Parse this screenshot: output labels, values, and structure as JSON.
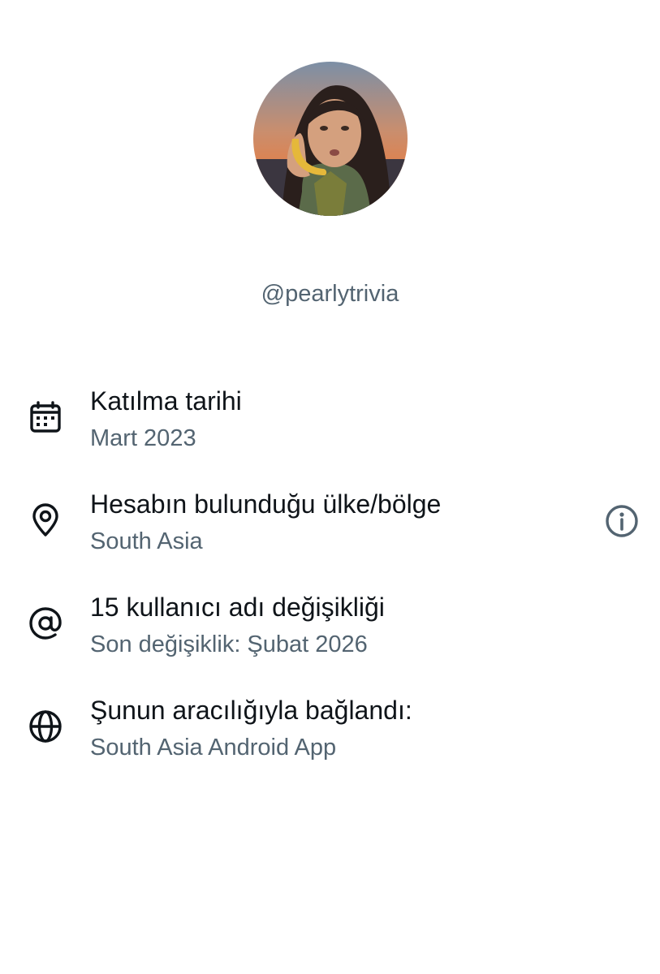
{
  "profile": {
    "handle": "@pearlytrivia",
    "avatar_description": "profile photo"
  },
  "about": {
    "items": [
      {
        "icon": "calendar-icon",
        "title": "Katılma tarihi",
        "subtitle": "Mart 2023"
      },
      {
        "icon": "location-pin-icon",
        "title": "Hesabın bulunduğu ülke/bölge",
        "subtitle": "South Asia"
      },
      {
        "icon": "at-sign-icon",
        "title": "15 kullanıcı adı değişikliği",
        "subtitle": "Son değişiklik: Şubat 2026"
      },
      {
        "icon": "globe-icon",
        "title": "Şunun aracılığıyla bağlandı:",
        "subtitle": "South Asia Android App"
      }
    ],
    "info_icon": "info-icon"
  },
  "colors": {
    "primary_text": "#0f1419",
    "secondary_text": "#536471",
    "background": "#ffffff"
  }
}
